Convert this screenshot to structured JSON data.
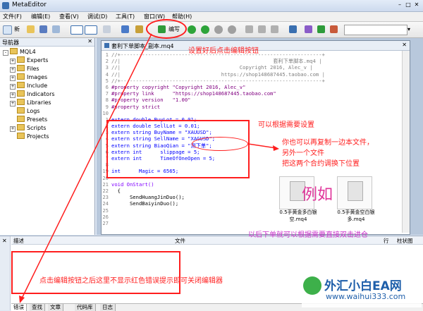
{
  "window": {
    "title": "MetaEditor"
  },
  "menu": [
    "文件(F)",
    "编辑(E)",
    "查看(V)",
    "调试(D)",
    "工具(T)",
    "窗口(W)",
    "帮助(H)"
  ],
  "toolbar": {
    "new_label": "新",
    "compile_label": "编写"
  },
  "navigator": {
    "title": "导航器",
    "root": "MQL4",
    "items": [
      "Experts",
      "Files",
      "Images",
      "Include",
      "Indicators",
      "Libraries",
      "Logs",
      "Presets",
      "Scripts",
      "Projects"
    ]
  },
  "document": {
    "tab_title": "套利下单脚本_副本.mq4"
  },
  "code_lines": [
    {
      "n": "1",
      "t": "//+------------------------------------------------------------------+",
      "c": "cm"
    },
    {
      "n": "2",
      "t": "//|                                                  套利下单脚本.mq4 |",
      "c": "cm"
    },
    {
      "n": "3",
      "t": "//|                                       Copyright 2016, Alec_v |",
      "c": "cm"
    },
    {
      "n": "4",
      "t": "//|                                 https://shop148687445.taobao.com |",
      "c": "cm"
    },
    {
      "n": "5",
      "t": "//+------------------------------------------------------------------+",
      "c": "cm"
    },
    {
      "n": "6",
      "t": "#property copyright \"Copyright 2016, Alec_v\"",
      "c": "pp"
    },
    {
      "n": "7",
      "t": "#property link      \"https://shop148687445.taobao.com\"",
      "c": "pp"
    },
    {
      "n": "8",
      "t": "#property version   \"1.00\"",
      "c": "pp"
    },
    {
      "n": "9",
      "t": "#property strict",
      "c": "pp"
    },
    {
      "n": "10",
      "t": "",
      "c": ""
    },
    {
      "n": "1",
      "t": "extern double BuyLot = 0.01;",
      "c": "kw"
    },
    {
      "n": "2",
      "t": "extern double SellLot = 0.01;",
      "c": "kw"
    },
    {
      "n": "3",
      "t": "extern string BuyName = \"XAUUSD\";",
      "c": "kw"
    },
    {
      "n": "4",
      "t": "extern string SellName = \"XAGUSD\";",
      "c": "kw"
    },
    {
      "n": "5",
      "t": "extern string BiaoQian = \"测下单\";",
      "c": "kw"
    },
    {
      "n": "6",
      "t": "extern int      slippage = 5;",
      "c": "kw"
    },
    {
      "n": "7",
      "t": "extern int      TimeOfOneOpen = 5;",
      "c": "kw"
    },
    {
      "n": "8",
      "t": "",
      "c": ""
    },
    {
      "n": "19",
      "t": "int      Magic = 6565;",
      "c": "kw"
    },
    {
      "n": "20",
      "t": "",
      "c": ""
    },
    {
      "n": "21",
      "t": "void OnStart()",
      "c": "fn"
    },
    {
      "n": "22",
      "t": "  {",
      "c": ""
    },
    {
      "n": "23",
      "t": "      SendHuangJinDuo();",
      "c": ""
    },
    {
      "n": "24",
      "t": "      SendBaiyinDuo();",
      "c": ""
    },
    {
      "n": "25",
      "t": "",
      "c": ""
    },
    {
      "n": "26",
      "t": "",
      "c": ""
    },
    {
      "n": "27",
      "t": "",
      "c": ""
    }
  ],
  "toolbox": {
    "col_desc": "描述",
    "col_file": "文件",
    "col_line": "行",
    "col_col": "柱状图",
    "tabs": [
      "错误",
      "查找",
      "文章",
      "代码库",
      "日志"
    ]
  },
  "annotations": {
    "compile_note": "设置好后点击编辑按钮",
    "settings_note": "可以根据需要设置",
    "copy_note_1": "你也可以再复制一边本文件，",
    "copy_note_2": "另外一个文件",
    "copy_note_3": "把这两个合约调换下位置",
    "example_label": "例如",
    "file1": "0.5手黄金多白银空.mq4",
    "file2": "0.5手黄金空白银多.mq4",
    "later_note": "以后下单就可以根据需要直接双击进仓",
    "bottom_note": "点击编辑按钮之后这里不显示红色错误提示即可关闭编辑器",
    "watermark_text": "外汇小白EA网",
    "watermark_url": "www.waihui333.com"
  },
  "colors": {
    "annotation_red": "#ff1e1e",
    "annotation_purple": "#cc33cc"
  }
}
